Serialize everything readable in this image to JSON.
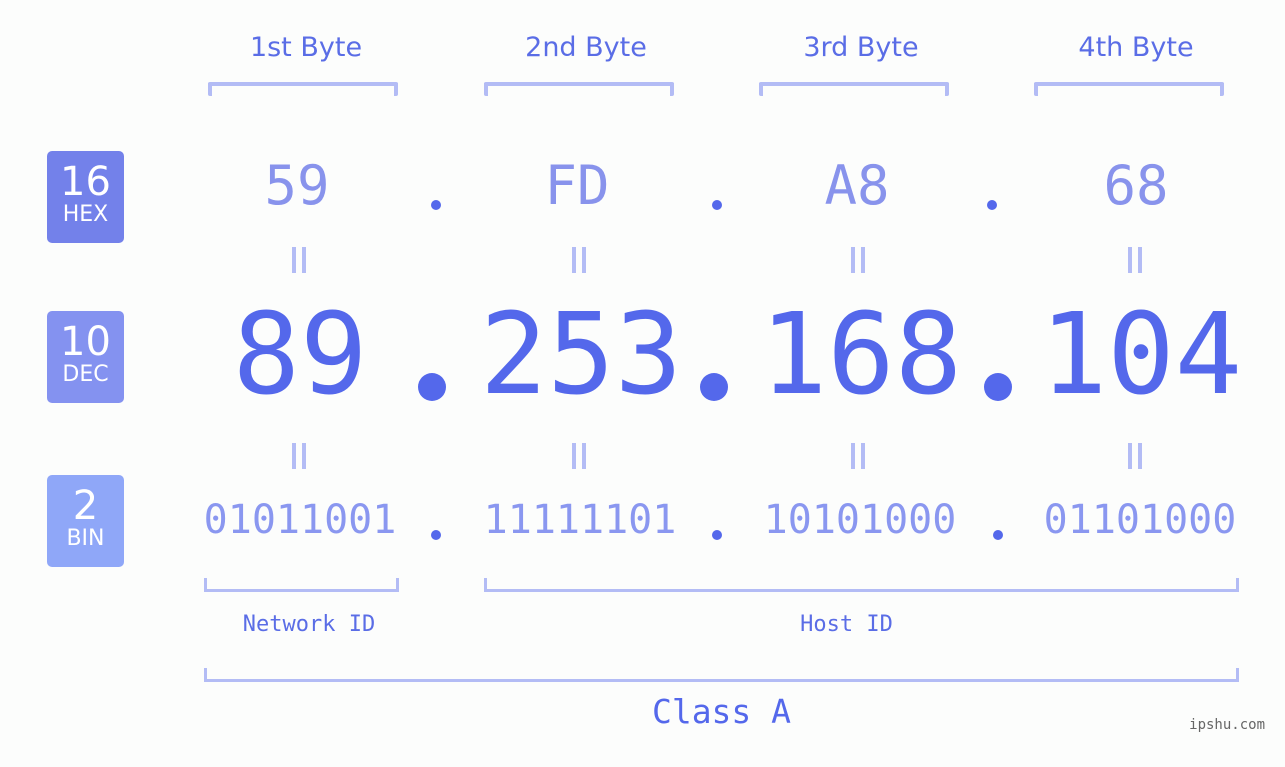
{
  "byte_headers": [
    "1st Byte",
    "2nd Byte",
    "3rd Byte",
    "4th Byte"
  ],
  "badges": {
    "hex": {
      "number": "16",
      "label": "HEX",
      "color": "#7381ea"
    },
    "dec": {
      "number": "10",
      "label": "DEC",
      "color": "#8492f0"
    },
    "bin": {
      "number": "2",
      "label": "BIN",
      "color": "#8fa7f8"
    }
  },
  "ip": {
    "hex": [
      "59",
      "FD",
      "A8",
      "68"
    ],
    "dec": [
      "89",
      "253",
      "168",
      "104"
    ],
    "bin": [
      "01011001",
      "11111101",
      "10101000",
      "01101000"
    ]
  },
  "separator": ".",
  "network_id_label": "Network ID",
  "host_id_label": "Host ID",
  "class_label": "Class A",
  "watermark": "ipshu.com",
  "colors": {
    "accent": "#5468eb",
    "bracket": "#b3bcf5",
    "hex_text": "#8893ec",
    "bin_text": "#8a97f0"
  }
}
